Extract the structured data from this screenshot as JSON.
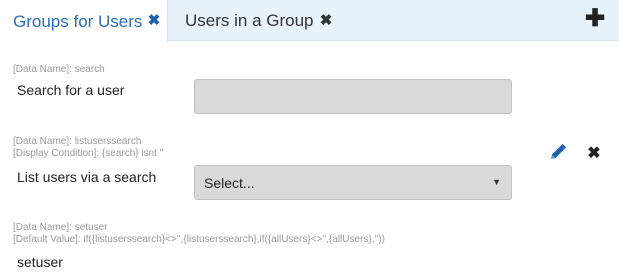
{
  "tabs": [
    {
      "label": "Groups for Users",
      "close_icon": "✖",
      "active": true
    },
    {
      "label": "Users in a Group",
      "close_icon": "✖",
      "active": false
    }
  ],
  "add_tab_icon": "✚",
  "fields": {
    "search": {
      "meta_line1": "[Data Name]: search",
      "label": "Search for a user",
      "value": ""
    },
    "listuserssearch": {
      "meta_line1": "[Data Name]: listuserssearch",
      "meta_line2": "[Display Condition]: {search} isnt ''",
      "label": "List users via a search",
      "selected": "Select...",
      "arrow": "▼"
    },
    "setuser": {
      "meta_line1": "[Data Name]: setuser",
      "meta_line2": "[Default Value]: if({listuserssearch}<>'',{listuserssearch},if({allUsers}<>'',{allUsers},''))",
      "label": "setuser"
    }
  },
  "actions": {
    "delete_icon": "✖"
  },
  "colors": {
    "accent": "#2a6ebd",
    "tabbar_bg": "#e8f2fb",
    "input_bg": "#d9d9d9",
    "meta_text": "#999999"
  }
}
